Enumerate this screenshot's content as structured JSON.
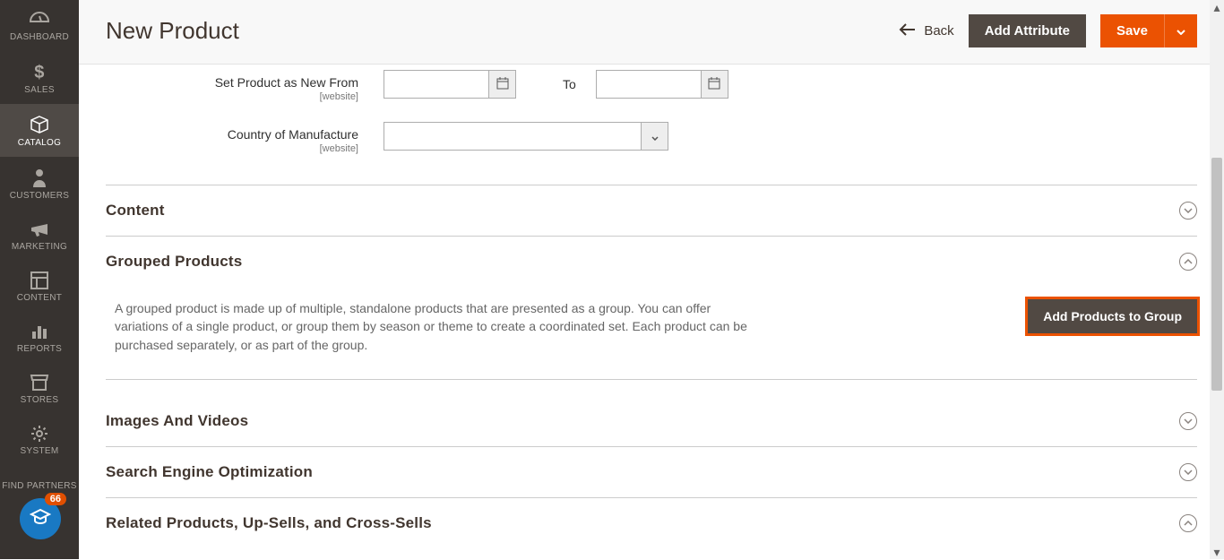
{
  "sidebar": {
    "items": [
      {
        "label": "DASHBOARD",
        "icon": "dashboard"
      },
      {
        "label": "SALES",
        "icon": "dollar"
      },
      {
        "label": "CATALOG",
        "icon": "box",
        "active": true
      },
      {
        "label": "CUSTOMERS",
        "icon": "person"
      },
      {
        "label": "MARKETING",
        "icon": "megaphone"
      },
      {
        "label": "CONTENT",
        "icon": "layout"
      },
      {
        "label": "REPORTS",
        "icon": "bars"
      },
      {
        "label": "STORES",
        "icon": "storefront"
      },
      {
        "label": "SYSTEM",
        "icon": "gear"
      },
      {
        "label": "FIND PARTNERS",
        "icon": ""
      }
    ]
  },
  "trainer": {
    "badge": "66"
  },
  "header": {
    "title": "New Product",
    "back": "Back",
    "add_attribute": "Add Attribute",
    "save": "Save"
  },
  "form": {
    "new_from_label": "Set Product as New From",
    "new_from_scope": "[website]",
    "new_from_value": "",
    "to_label": "To",
    "new_to_value": "",
    "country_label": "Country of Manufacture",
    "country_scope": "[website]",
    "country_value": ""
  },
  "sections": {
    "content": {
      "title": "Content"
    },
    "grouped": {
      "title": "Grouped Products",
      "desc": "A grouped product is made up of multiple, standalone products that are presented as a group. You can offer variations of a single product, or group them by season or theme to create a coordinated set. Each product can be purchased separately, or as part of the group.",
      "add_button": "Add Products to Group"
    },
    "images": {
      "title": "Images And Videos"
    },
    "seo": {
      "title": "Search Engine Optimization"
    },
    "related": {
      "title": "Related Products, Up-Sells, and Cross-Sells"
    }
  }
}
